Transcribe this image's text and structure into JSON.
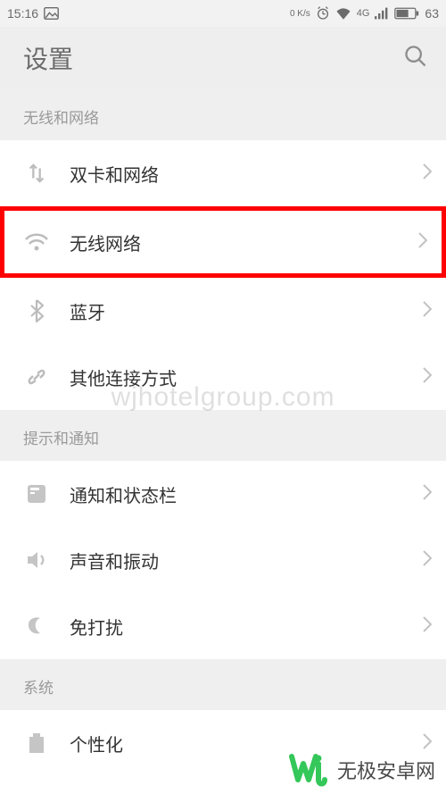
{
  "status": {
    "time": "15:16",
    "net_speed": "0 K/s",
    "battery": "63"
  },
  "header": {
    "title": "设置"
  },
  "sections": [
    {
      "title": "无线和网络",
      "items": [
        {
          "name": "sim-network",
          "label": "双卡和网络",
          "icon": "swap-vertical-icon",
          "highlight": false
        },
        {
          "name": "wifi",
          "label": "无线网络",
          "icon": "wifi-icon",
          "highlight": true
        },
        {
          "name": "bluetooth",
          "label": "蓝牙",
          "icon": "bluetooth-icon",
          "highlight": false
        },
        {
          "name": "other-connect",
          "label": "其他连接方式",
          "icon": "link-icon",
          "highlight": false
        }
      ]
    },
    {
      "title": "提示和通知",
      "items": [
        {
          "name": "notification",
          "label": "通知和状态栏",
          "icon": "notification-panel-icon",
          "highlight": false
        },
        {
          "name": "sound",
          "label": "声音和振动",
          "icon": "volume-icon",
          "highlight": false
        },
        {
          "name": "dnd",
          "label": "免打扰",
          "icon": "moon-icon",
          "highlight": false
        }
      ]
    },
    {
      "title": "系统",
      "items": [
        {
          "name": "personalization",
          "label": "个性化",
          "icon": "theme-icon",
          "highlight": false
        }
      ]
    }
  ],
  "watermark": "wjhotelgroup.com",
  "footer_brand": "无极安卓网"
}
